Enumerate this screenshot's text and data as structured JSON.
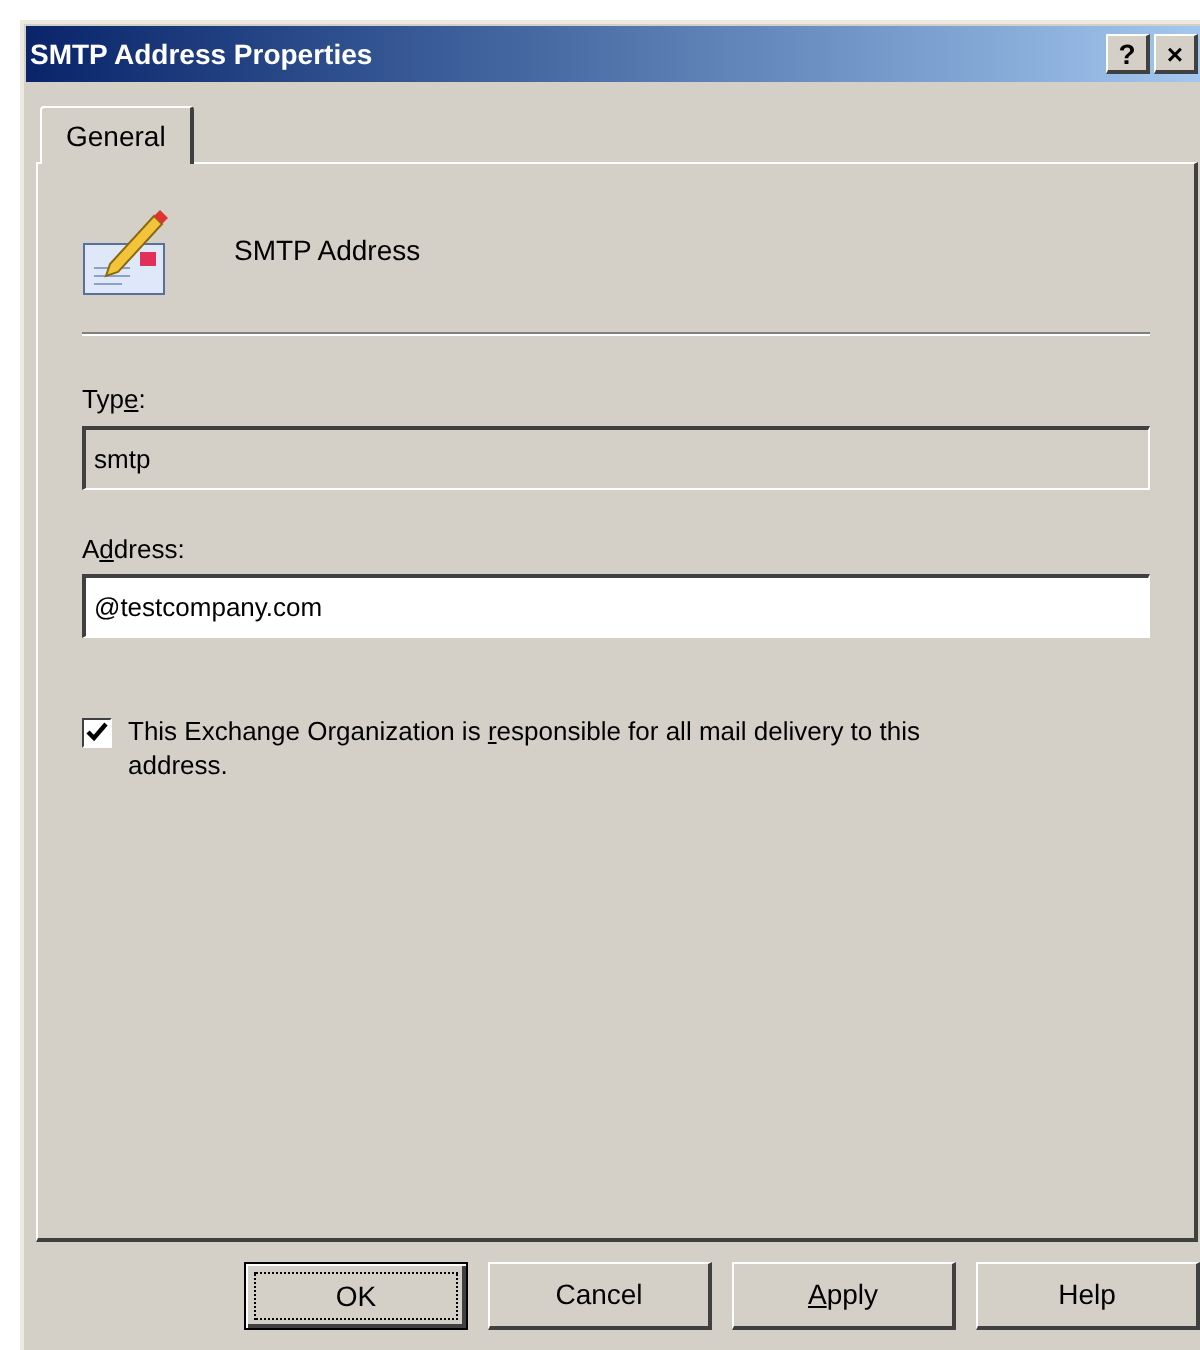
{
  "window": {
    "title": "SMTP Address Properties",
    "title_buttons": [
      "?",
      "×"
    ]
  },
  "tabs": [
    {
      "label": "General",
      "selected": true
    }
  ],
  "header": {
    "title": "SMTP Address"
  },
  "fields": [
    {
      "label": [
        {
          "text": "Typ",
          "underlined": false
        },
        {
          "text": "e",
          "underlined": true
        },
        {
          "text": ":",
          "underlined": false
        }
      ],
      "value": "smtp",
      "disabled": true
    },
    {
      "label": [
        {
          "text": "A",
          "underlined": false
        },
        {
          "text": "d",
          "underlined": true
        },
        {
          "text": "dress:",
          "underlined": false
        }
      ],
      "value": "@testcompany.com",
      "disabled": false
    }
  ],
  "checkbox": {
    "label": [
      {
        "text": "This Exchange Organization is ",
        "underlined": false
      },
      {
        "text": "r",
        "underlined": true
      },
      {
        "text": "esponsible for all mail delivery to this address.",
        "underlined": false
      }
    ],
    "checked": true
  },
  "buttons": [
    {
      "label": [
        {
          "text": "OK",
          "underlined": false
        }
      ],
      "default": true
    },
    {
      "label": [
        {
          "text": "Cancel",
          "underlined": false
        }
      ],
      "default": false
    },
    {
      "label": [
        {
          "text": "A",
          "underlined": true
        },
        {
          "text": "pply",
          "underlined": false
        }
      ],
      "default": false
    },
    {
      "label": [
        {
          "text": "Help",
          "underlined": false
        }
      ],
      "default": false
    }
  ]
}
